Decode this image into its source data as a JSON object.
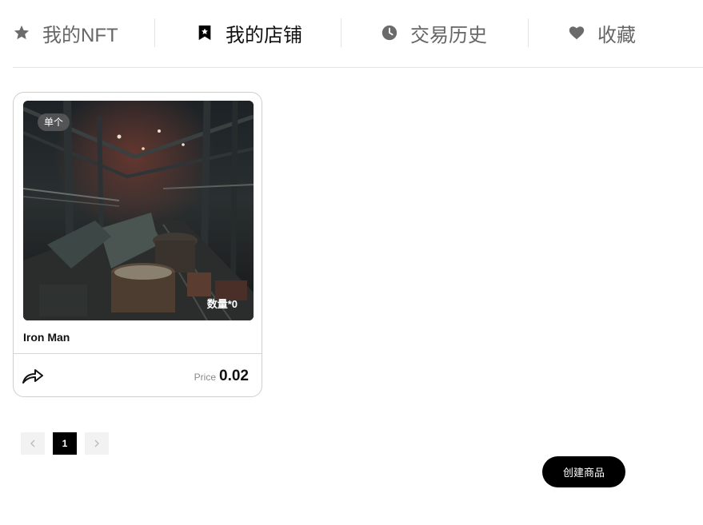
{
  "tabs": [
    {
      "label": "我的NFT",
      "icon": "star-icon"
    },
    {
      "label": "我的店铺",
      "icon": "bookmark-star-icon"
    },
    {
      "label": "交易历史",
      "icon": "clock-icon"
    },
    {
      "label": "收藏",
      "icon": "heart-icon"
    }
  ],
  "active_tab": "我的店铺",
  "products": [
    {
      "badge": "单个",
      "quantity_label": "数量*0",
      "title": "Iron Man",
      "price_label": "Price",
      "price_value": "0.02",
      "share_icon": "share-arrow-icon"
    }
  ],
  "pagination": {
    "prev_icon": "chevron-left-icon",
    "current_page": "1",
    "next_icon": "chevron-right-icon"
  },
  "actions": {
    "create_label": "创建商品"
  },
  "colors": {
    "active_text": "#111111",
    "inactive_text": "#666666",
    "button_bg": "#000000"
  }
}
